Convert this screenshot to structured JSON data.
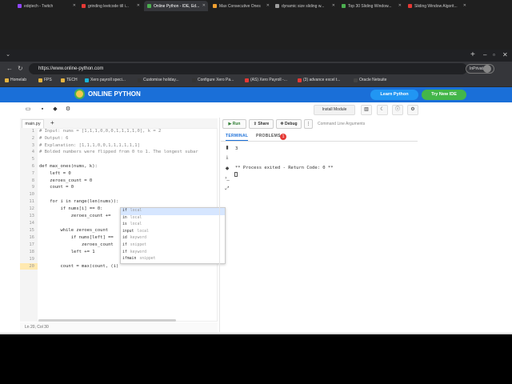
{
  "browser": {
    "tabs": [
      {
        "label": "edqtech - Twitch",
        "color": "#9146ff"
      },
      {
        "label": "grinding leetcode till i...",
        "color": "#e53935"
      },
      {
        "label": "Online Python - IDE, Ed...",
        "color": "#4caf50",
        "active": true
      },
      {
        "label": "Max Consecutive Ones",
        "color": "#f0a030"
      },
      {
        "label": "dynamic size sliding w...",
        "color": "#9e9e9e"
      },
      {
        "label": "Top 30 Sliding Window...",
        "color": "#4caf50"
      },
      {
        "label": "Sliding Window Algorit...",
        "color": "#e53935"
      }
    ],
    "url": "https://www.online-python.com",
    "inprivate": "InPrivate",
    "bookmarks": [
      "Homelab",
      "FPS",
      "TECH",
      "Xero payroll speci...",
      "Customise holiday...",
      "Configure Xero Pa...",
      "(AS) Xero Payroll -...",
      "(3) advance excel t...",
      "Oracle Netsuite"
    ]
  },
  "site": {
    "brand": "ONLINE PYTHON",
    "learn_python": "Learn Python",
    "try_new_ide": "Try New IDE",
    "install_module": "Install Module"
  },
  "editor": {
    "file_tab": "main.py",
    "add_tab": "+",
    "line_numbers": [
      "1",
      "2",
      "3",
      "4",
      "5",
      "6",
      "7",
      "8",
      "9",
      "10",
      "11",
      "12",
      "13",
      "14",
      "15",
      "16",
      "17",
      "18",
      "19",
      "20"
    ],
    "lines": [
      "# Input: nums = [1,1,1,0,0,0,1,1,1,1,0], k = 2",
      "# Output: 6",
      "# Explanation: [1,1,1,0,0,1,1,1,1,1,1]",
      "# Bolded numbers were flipped from 0 to 1. The longest subar",
      "",
      "def max_ones(nums, k):",
      "    left = 0",
      "    zeroes_count = 0",
      "    count = 0",
      "",
      "    for i in range(len(nums)):",
      "        if nums[i] == 0:",
      "            zeroes_count +=",
      "",
      "        while zeroes_count",
      "            if nums[left] ==",
      "                zeroes_count",
      "            left += 1",
      "",
      "        count = max(count, (i)"
    ],
    "status": "Ln 20, Col 30",
    "autocomplete": [
      {
        "label": "if",
        "kind": "local"
      },
      {
        "label": "in",
        "kind": "local"
      },
      {
        "label": "is",
        "kind": "local"
      },
      {
        "label": "input",
        "kind": "local"
      },
      {
        "label": "id",
        "kind": "keyword"
      },
      {
        "label": "if",
        "kind": "snippet"
      },
      {
        "label": "if",
        "kind": "keyword"
      },
      {
        "label": "ifmain",
        "kind": "snippet"
      }
    ]
  },
  "run": {
    "run_label": "Run",
    "share_label": "Share",
    "debug_label": "Debug",
    "args_placeholder": "Command Line Arguments"
  },
  "terminal": {
    "tab_terminal": "TERMINAL",
    "tab_problems": "PROBLEMS",
    "problems_count": "1",
    "output_lines": [
      "3",
      "",
      "",
      "** Process exited - Return Code: 0 **"
    ]
  }
}
